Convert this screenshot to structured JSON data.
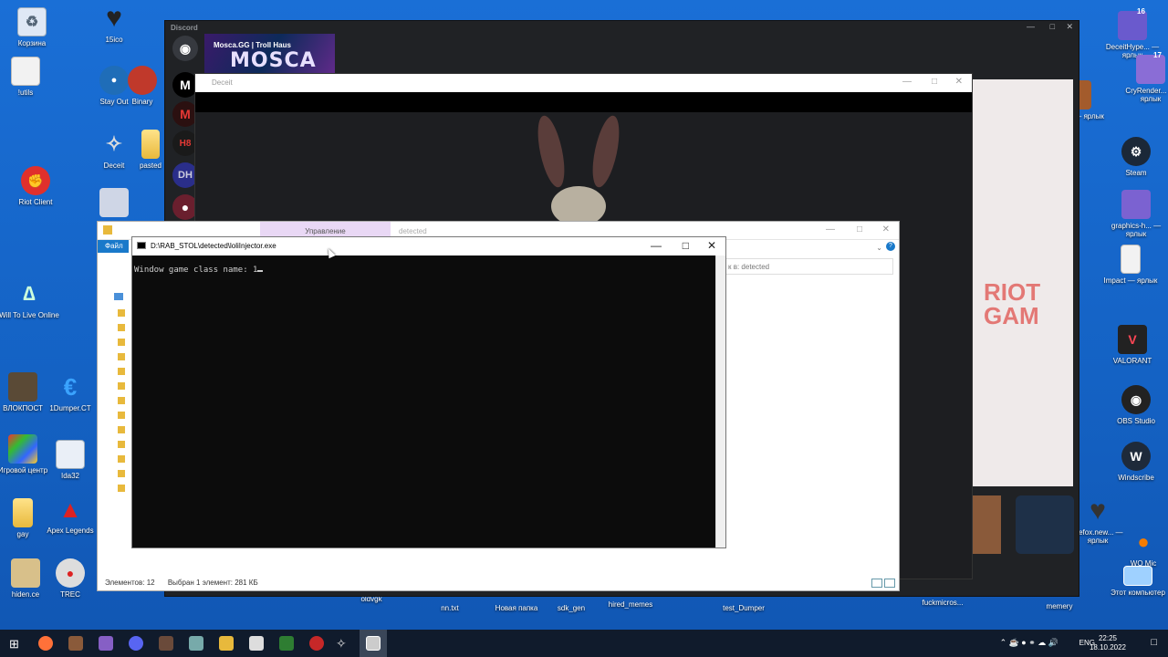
{
  "desktop_icons": [
    {
      "label": "Корзина"
    },
    {
      "label": "15ico"
    },
    {
      "label": "!utils"
    },
    {
      "label": "Stay Out"
    },
    {
      "label": "Binary"
    },
    {
      "label": "Deceit"
    },
    {
      "label": "pasted"
    },
    {
      "label": "Riot Client"
    },
    {
      "label": "Will To Live Online"
    },
    {
      "label": "ВЛОКПОСТ"
    },
    {
      "label": "1Dumper.CT"
    },
    {
      "label": "Игровой центр"
    },
    {
      "label": "Ida32"
    },
    {
      "label": "gay"
    },
    {
      "label": "Apex Legends"
    },
    {
      "label": "hiden.ce"
    },
    {
      "label": "TREC"
    },
    {
      "label": "DeceitHype... — ярлык"
    },
    {
      "label": "CryRender... — ярлык"
    },
    {
      "label": "pos — ярлык"
    },
    {
      "label": "Steam"
    },
    {
      "label": "graphics-h... — ярлык"
    },
    {
      "label": "Impact — ярлык"
    },
    {
      "label": "VALORANT"
    },
    {
      "label": "OBS Studio"
    },
    {
      "label": "Windscribe"
    },
    {
      "label": "firefox.new... — ярлык"
    },
    {
      "label": "WO Mic"
    },
    {
      "label": "Этот компьютер"
    },
    {
      "label": "oldvgk"
    },
    {
      "label": "nn.txt"
    },
    {
      "label": "Новая папка"
    },
    {
      "label": "sdk_gen"
    },
    {
      "label": "hired_memes"
    },
    {
      "label": "test_Dumper"
    },
    {
      "label": "fuckmicros..."
    },
    {
      "label": "memery"
    }
  ],
  "badges": {
    "deceit_hype": "16",
    "cry_render": "17"
  },
  "discord": {
    "title": "Discord",
    "banner_server": "Mosca.GG | Troll Haus",
    "banner_text": "MOSCA",
    "servers": [
      "M",
      "M",
      "H8",
      "DH"
    ],
    "riot_text": "RIOT GAM"
  },
  "deceit": {
    "title": "Deceit"
  },
  "explorer": {
    "manage_tab": "Управление",
    "folder_tab": "detected",
    "file_tab": "Файл",
    "search_placeholder": "к в: detected",
    "items_count": "Элементов: 12",
    "selected": "Выбран 1 элемент: 281 КБ"
  },
  "console": {
    "title": "D:\\RAB_STOL\\detected\\loliInjector.exe",
    "line": "Window game class name: 1"
  },
  "taskbar": {
    "lang": "ENG",
    "time": "22:25",
    "date": "18.10.2022"
  },
  "colors": {
    "desktop": "#1663c9",
    "taskbar": "#101b2c",
    "console_bg": "#0c0c0c",
    "explorer_accent": "#1979ca"
  }
}
